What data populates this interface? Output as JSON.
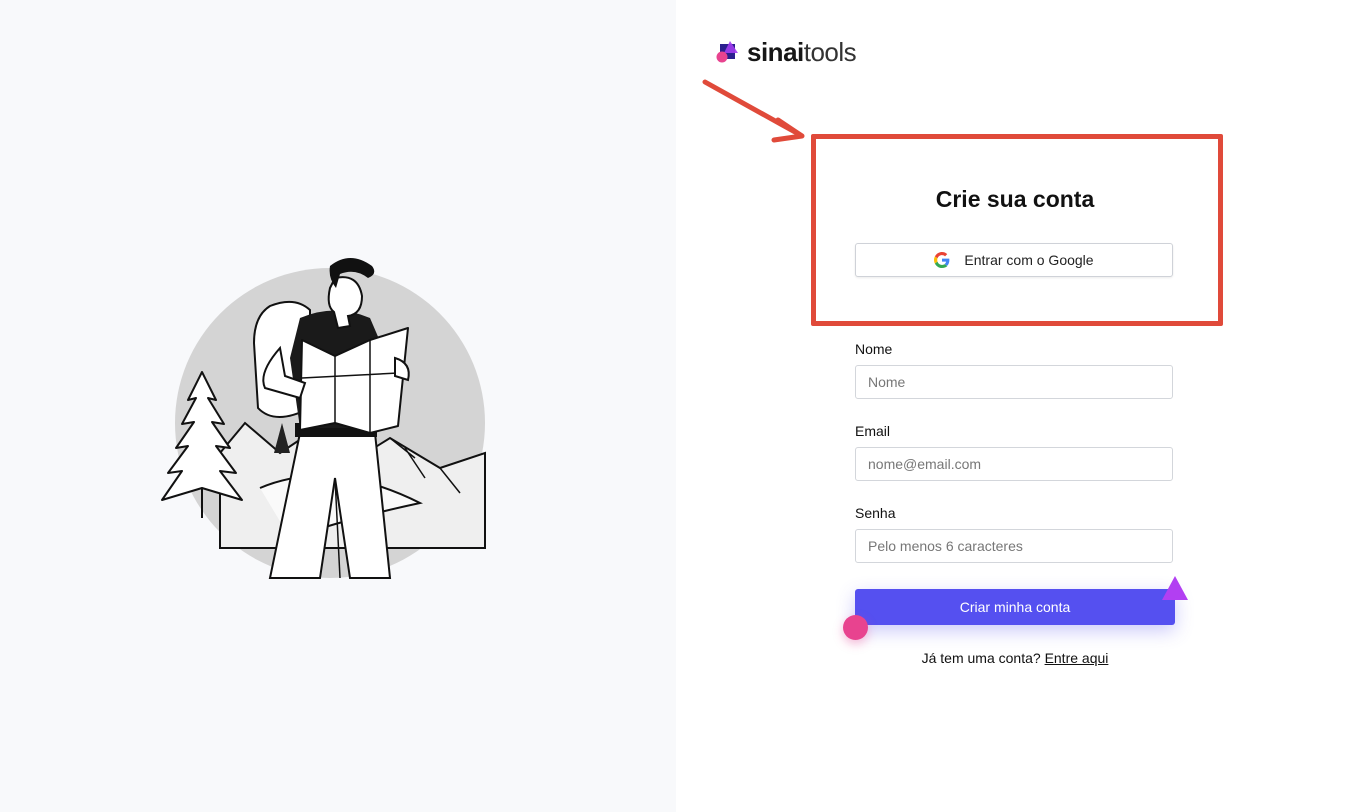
{
  "brand": {
    "name_strong": "sinai",
    "name_light": "tools",
    "colors": {
      "mark_navy": "#2b1f8f",
      "mark_purple": "#a23cf0",
      "mark_pink": "#e8438f"
    }
  },
  "annotation": {
    "color": "#e04a3a"
  },
  "signup": {
    "title": "Crie sua conta",
    "google_button_label": "Entrar com o Google",
    "fields": {
      "name": {
        "label": "Nome",
        "placeholder": "Nome"
      },
      "email": {
        "label": "Email",
        "placeholder": "nome@email.com"
      },
      "password": {
        "label": "Senha",
        "placeholder": "Pelo menos 6 caracteres"
      }
    },
    "submit_label": "Criar minha conta",
    "submit_color": "#5550f0",
    "login_prompt": "Já tem uma conta?",
    "login_link": "Entre aqui"
  },
  "icons": {
    "google": "google-g-icon",
    "logo_mark": "sinai-logo-mark-icon",
    "illustration": "hiker-with-map-illustration"
  }
}
